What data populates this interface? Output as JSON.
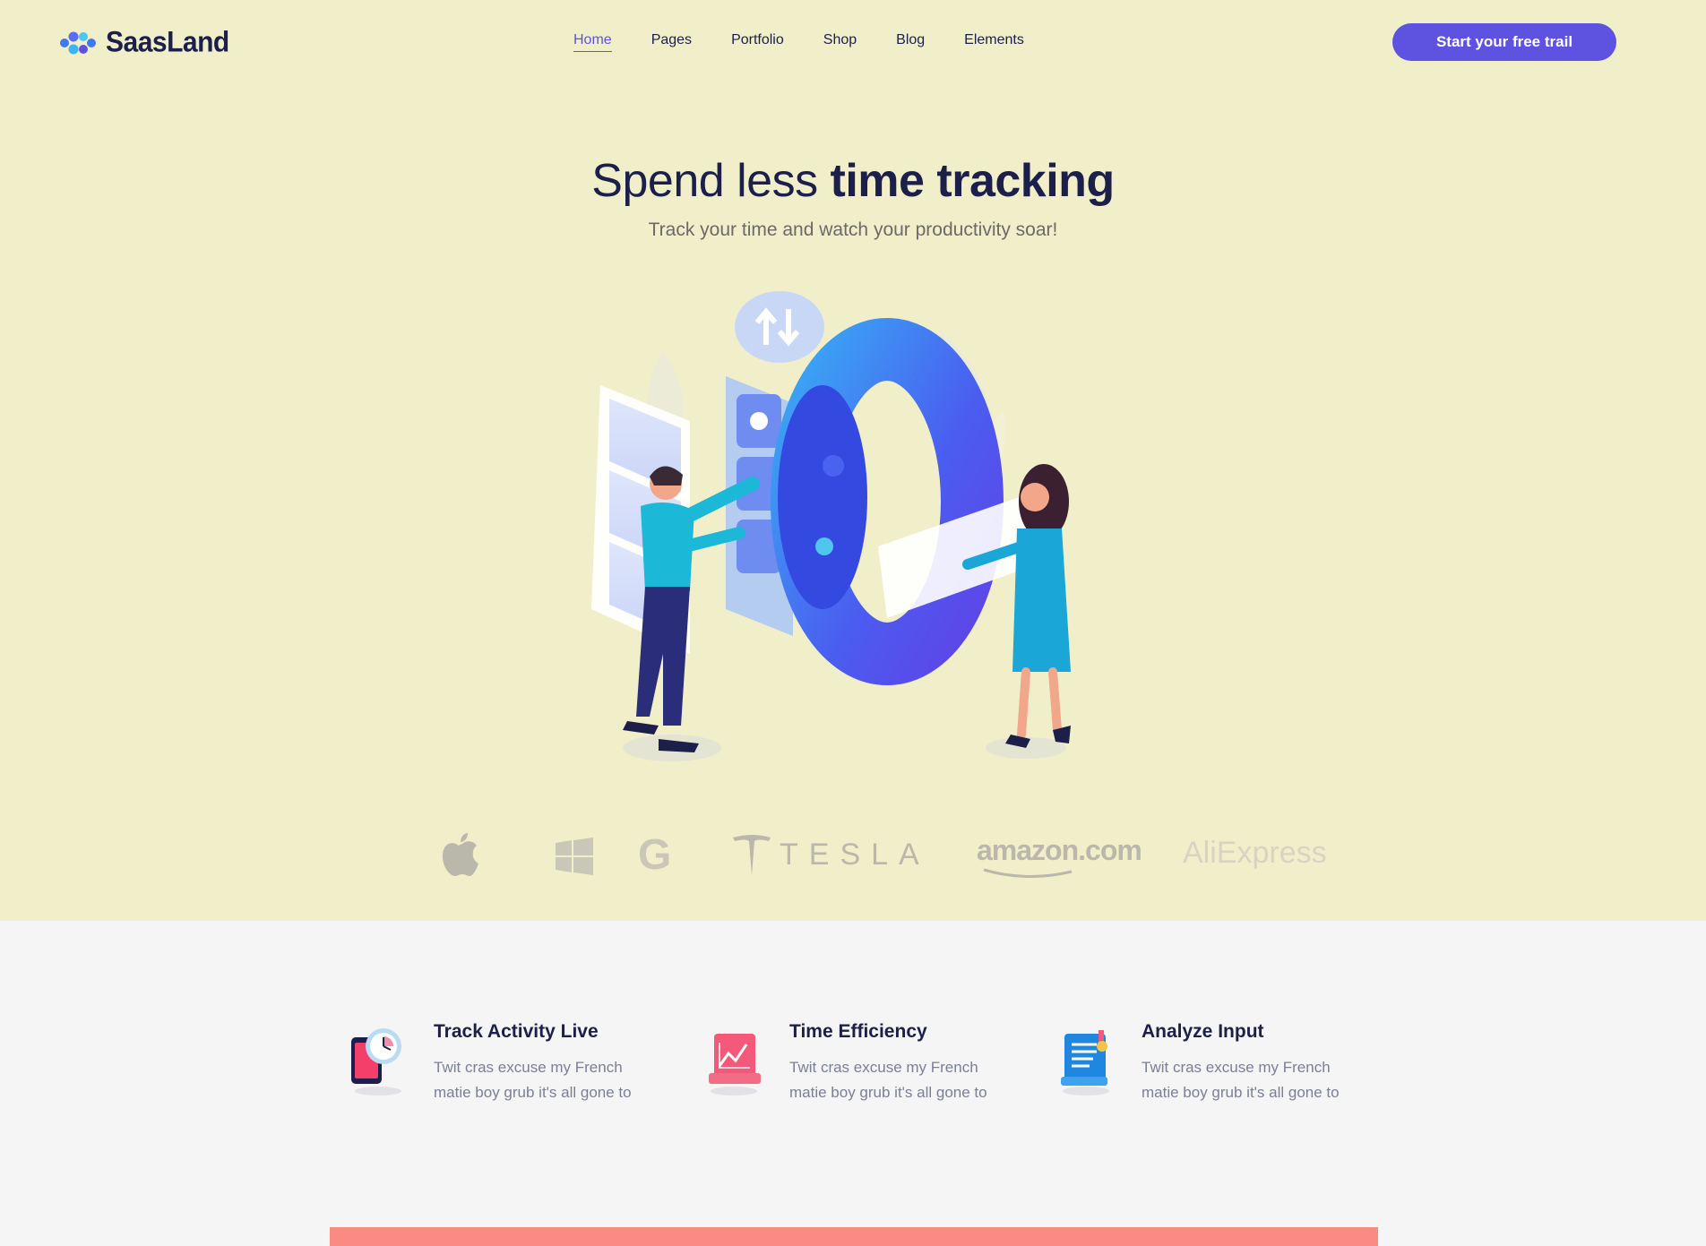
{
  "brand": {
    "name": "SaasLand",
    "logo_icon": "saasland-logo-icon"
  },
  "nav": {
    "items": [
      {
        "label": "Home",
        "active": true
      },
      {
        "label": "Pages",
        "active": false
      },
      {
        "label": "Portfolio",
        "active": false
      },
      {
        "label": "Shop",
        "active": false
      },
      {
        "label": "Blog",
        "active": false
      },
      {
        "label": "Elements",
        "active": false
      }
    ]
  },
  "cta": {
    "label": "Start your free trail"
  },
  "hero": {
    "title_light": "Spend less ",
    "title_bold": "time tracking",
    "subtitle": "Track your time and watch your productivity soar!"
  },
  "partners": {
    "tesla": "TESLA",
    "amazon": "amazon.com",
    "aliexpress": "AliExpress",
    "google": "G"
  },
  "features": [
    {
      "icon": "phone-clock-icon",
      "title": "Track Activity Live",
      "desc": "Twit cras excuse my French matie boy grub it's all gone to"
    },
    {
      "icon": "chart-board-icon",
      "title": "Time Efficiency",
      "desc": "Twit cras excuse my French matie boy grub it's all gone to"
    },
    {
      "icon": "document-scroll-icon",
      "title": "Analyze Input",
      "desc": "Twit cras excuse my French matie boy grub it's all gone to"
    }
  ],
  "colors": {
    "hero_bg": "#f1efc9",
    "accent": "#5e53e1",
    "heading": "#1c1f4a",
    "coral": "#fb8a82"
  }
}
